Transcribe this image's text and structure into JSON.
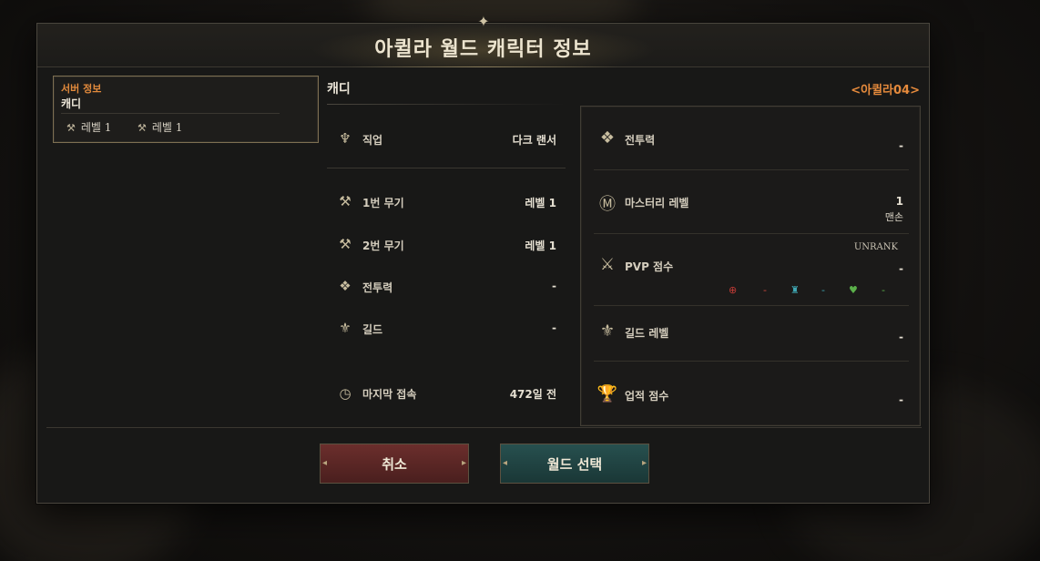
{
  "dialog": {
    "title": "아퀼라 월드 캐릭터 정보"
  },
  "server_panel": {
    "label": "서버 정보",
    "character": "캐디",
    "levels": [
      "레벨 1",
      "레벨 1"
    ]
  },
  "character": {
    "name": "캐디",
    "server_tag": "<아퀼라04>"
  },
  "info_rows": [
    {
      "label": "직업",
      "value": "다크 랜서",
      "icon": "class-icon"
    },
    {
      "label": "1번 무기",
      "value": "레벨 1",
      "icon": "weapon-icon"
    },
    {
      "label": "2번 무기",
      "value": "레벨 1",
      "icon": "weapon-icon"
    },
    {
      "label": "전투력",
      "value": "-",
      "icon": "combat-power-icon"
    },
    {
      "label": "길드",
      "value": "-",
      "icon": "guild-icon"
    },
    {
      "label": "마지막 접속",
      "value": "472일 전",
      "icon": "clock-icon"
    }
  ],
  "stats": {
    "combat_power": {
      "label": "전투력",
      "value": "-"
    },
    "mastery": {
      "label": "마스터리 레벨",
      "value": "1",
      "sub": "맨손"
    },
    "pvp": {
      "label": "PVP 점수",
      "rank": "UNRANK",
      "value": "-",
      "mini": [
        "-",
        "-",
        "-"
      ]
    },
    "guild_level": {
      "label": "길드 레벨",
      "value": "-"
    },
    "achievement": {
      "label": "업적 점수",
      "value": "-"
    }
  },
  "buttons": {
    "cancel": "취소",
    "world_select": "월드 선택"
  },
  "colors": {
    "accent_orange": "#e58a3c",
    "cancel_red": "#6b2e2c",
    "select_teal": "#27504f"
  }
}
